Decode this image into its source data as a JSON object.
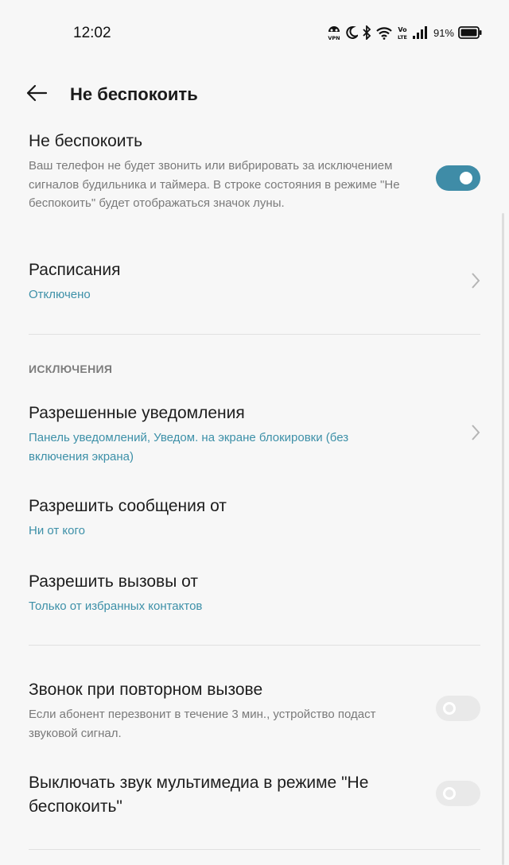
{
  "status_bar": {
    "time": "12:02",
    "battery": "91%",
    "icons": [
      "vpn-icon",
      "moon-icon",
      "bluetooth-icon",
      "wifi-icon",
      "volte-icon",
      "signal-icon",
      "battery-icon"
    ]
  },
  "header": {
    "title": "Не беспокоить"
  },
  "dnd": {
    "title": "Не беспокоить",
    "description": "Ваш телефон не будет звонить или вибрировать за исключением сигналов будильника и таймера. В строке состояния в режиме \"Не беспокоить\" будет отображаться значок луны.",
    "enabled": true
  },
  "schedules": {
    "title": "Расписания",
    "value": "Отключено"
  },
  "exceptions": {
    "header": "ИСКЛЮЧЕНИЯ",
    "allowed_notifications": {
      "title": "Разрешенные уведомления",
      "value": "Панель уведомлений, Уведом. на экране блокировки (без включения экрана)"
    },
    "allow_messages": {
      "title": "Разрешить сообщения от",
      "value": "Ни от кого"
    },
    "allow_calls": {
      "title": "Разрешить вызовы от",
      "value": "Только от избранных контактов"
    }
  },
  "repeat_calls": {
    "title": "Звонок при повторном вызове",
    "description": "Если абонент перезвонит в течение 3 мин., устройство подаст звуковой сигнал.",
    "enabled": false
  },
  "mute_media": {
    "title": "Выключать звук мультимедиа в режиме \"Не беспокоить\"",
    "enabled": false
  },
  "colors": {
    "accent": "#3f8ca7",
    "link": "#3d90a8",
    "background": "#f7f7f7"
  }
}
